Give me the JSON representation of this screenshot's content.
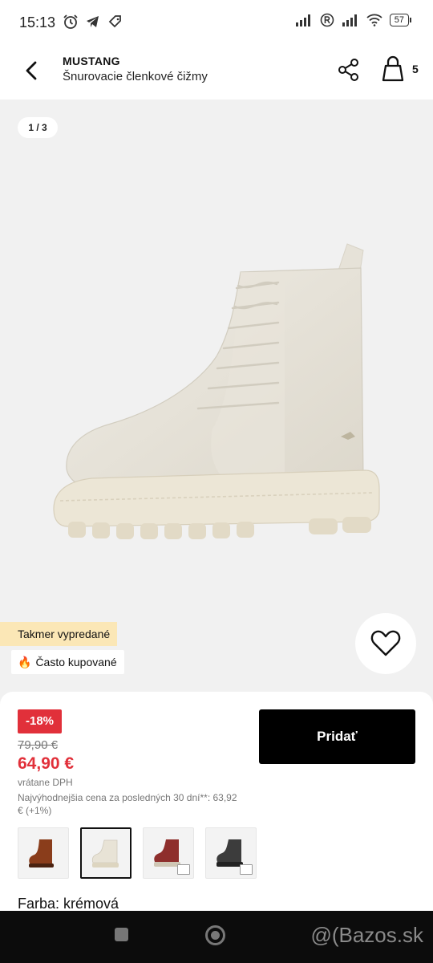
{
  "status_bar": {
    "time": "15:13",
    "battery": "57",
    "left_icons": [
      "alarm-icon",
      "telegram-icon",
      "tag-icon"
    ],
    "right_icons": [
      "signal-icon",
      "registered-icon",
      "signal-icon",
      "wifi-icon",
      "battery-icon"
    ]
  },
  "header": {
    "brand": "MUSTANG",
    "product_name": "Šnurovacie členkové čižmy",
    "bag_count": "5",
    "icons": [
      "back-arrow-icon",
      "share-icon",
      "shopping-bag-icon"
    ]
  },
  "gallery": {
    "counter": "1 / 3",
    "tags": {
      "soldout": "Takmer vypredané",
      "popular": "Často kupované",
      "popular_icon": "🔥"
    },
    "wishlist_icon": "heart-icon",
    "product_color": "#e9e5da"
  },
  "purchase": {
    "discount": "-18%",
    "price_old": "79,90 €",
    "price_new": "64,90 €",
    "vat_note": "vrátane DPH",
    "lowest_price_note": "Najvýhodnejšia cena za posledných 30 dní**: 63,92 € (+1%)",
    "add_button": "Pridať",
    "color_label": "Farba:",
    "color_value": "krémová",
    "swatches": [
      {
        "color": "#8a3d1b",
        "selected": false,
        "available": true
      },
      {
        "color": "#e8e3d6",
        "selected": true,
        "available": true
      },
      {
        "color": "#8e2e2c",
        "selected": false,
        "available": false
      },
      {
        "color": "#3c3c3c",
        "selected": false,
        "available": false
      }
    ]
  },
  "nav": {
    "watermark": "@(Bazos.sk"
  },
  "colors": {
    "sale_red": "#e1303a",
    "soldout_tag_bg": "#fbe7b6",
    "button_black": "#000000"
  }
}
